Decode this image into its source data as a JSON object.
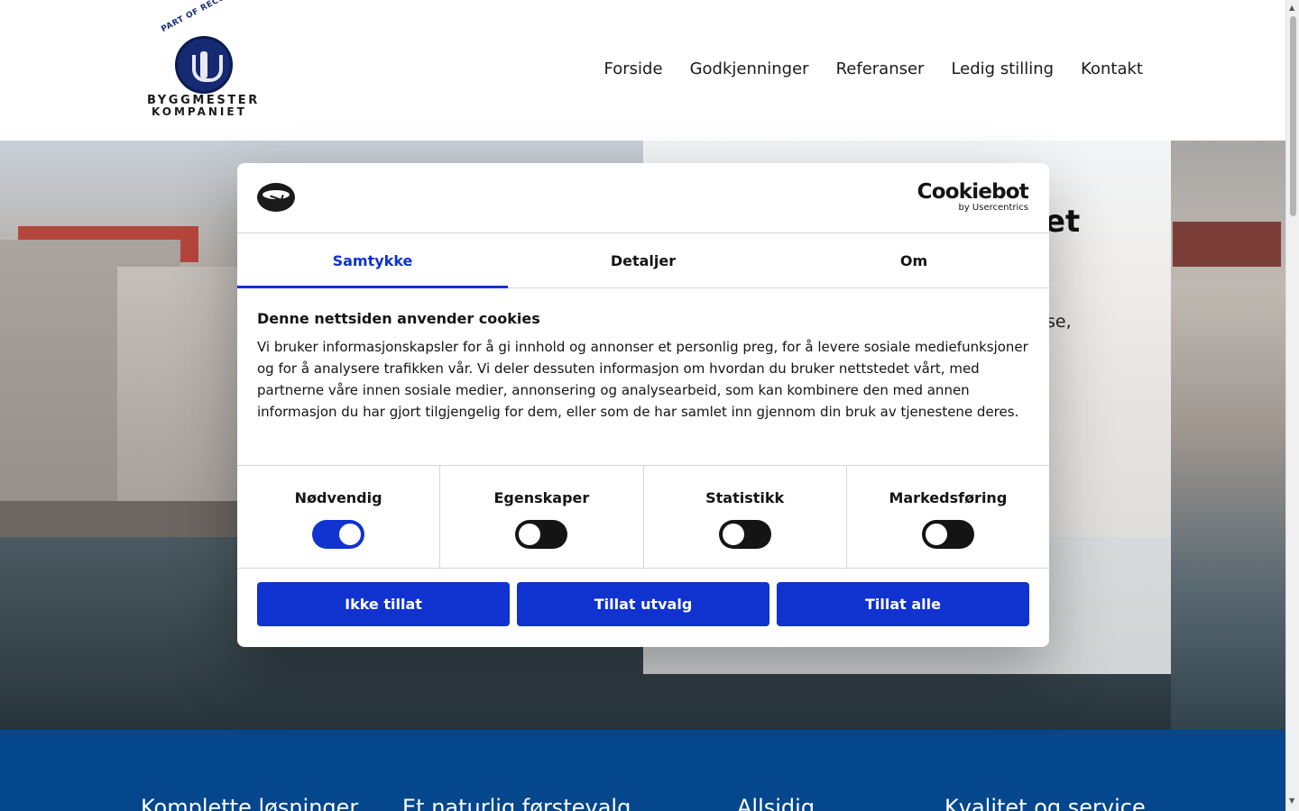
{
  "logo": {
    "arc_text": "PART OF RECOVER",
    "word1": "BYGGMESTER",
    "word2": "KOMPANIET"
  },
  "nav": [
    "Forside",
    "Godkjenninger",
    "Referanser",
    "Ledig stilling",
    "Kontakt"
  ],
  "hero": {
    "title_fragment": "et",
    "text_fragment": "se,"
  },
  "band": [
    "Komplette løsninger",
    "Et naturlig førstevalg",
    "Allsidig",
    "Kvalitet og service"
  ],
  "cookie": {
    "brand": "Cookiebot",
    "brand_by": "by Usercentrics",
    "tabs": [
      "Samtykke",
      "Detaljer",
      "Om"
    ],
    "title": "Denne nettsiden anvender cookies",
    "text": "Vi bruker informasjonskapsler for å gi innhold og annonser et personlig preg, for å levere sosiale mediefunksjoner og for å analysere trafikken vår. Vi deler dessuten informasjon om hvordan du bruker nettstedet vårt, med partnerne våre innen sosiale medier, annonsering og analysearbeid, som kan kombinere den med annen informasjon du har gjort tilgjengelig for dem, eller som de har samlet inn gjennom din bruk av tjenestene deres.",
    "toggles": [
      {
        "label": "Nødvendig",
        "on": true
      },
      {
        "label": "Egenskaper",
        "on": false
      },
      {
        "label": "Statistikk",
        "on": false
      },
      {
        "label": "Markedsføring",
        "on": false
      }
    ],
    "buttons": [
      "Ikke tillat",
      "Tillat utvalg",
      "Tillat alle"
    ]
  },
  "colors": {
    "accent": "#1032cf",
    "band": "#04478c"
  }
}
